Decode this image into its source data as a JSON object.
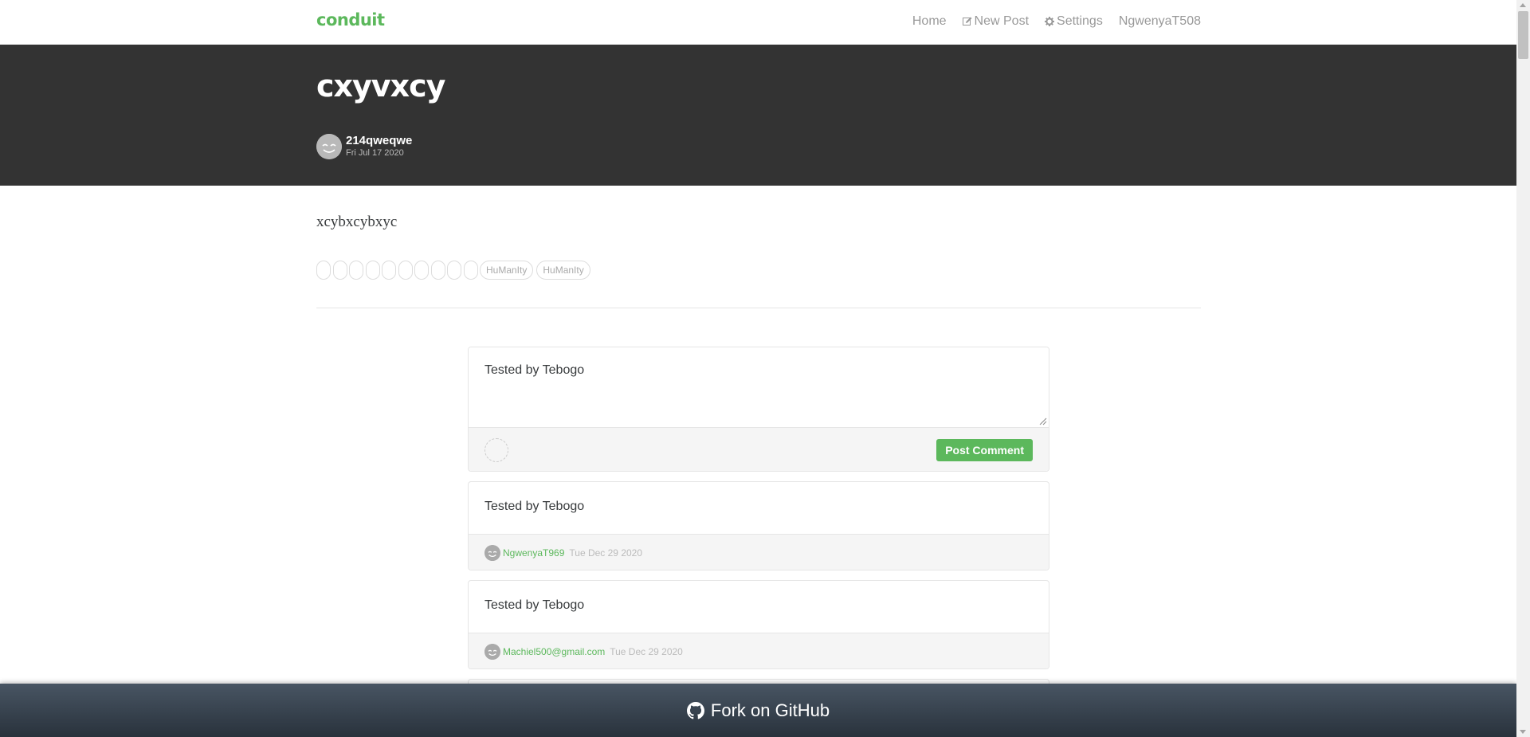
{
  "nav": {
    "brand": "conduit",
    "home": "Home",
    "new_post": "New Post",
    "settings": "Settings",
    "user": "NgwenyaT508",
    "icons": {
      "new_post": "edit-icon",
      "settings": "gear-icon"
    }
  },
  "article": {
    "title": "cxyvxcy",
    "author": "214qweqwe",
    "date": "Fri Jul 17 2020",
    "body": "xcybxcybxyc",
    "empty_tag_count": 10,
    "tags": [
      "HuManIty",
      "HuManIty"
    ]
  },
  "comment_form": {
    "value": "Tested by Tebogo",
    "submit_label": "Post Comment"
  },
  "comments": [
    {
      "body": "Tested by Tebogo",
      "author": "NgwenyaT969",
      "date": "Tue Dec 29 2020"
    },
    {
      "body": "Tested by Tebogo",
      "author": "Machiel500@gmail.com",
      "date": "Tue Dec 29 2020"
    }
  ],
  "footer": {
    "label": "Fork on GitHub",
    "icon": "github-icon"
  },
  "colors": {
    "brand": "#5cb85c",
    "banner": "#333333",
    "footer_top": "#485563",
    "footer_bottom": "#29323c"
  }
}
